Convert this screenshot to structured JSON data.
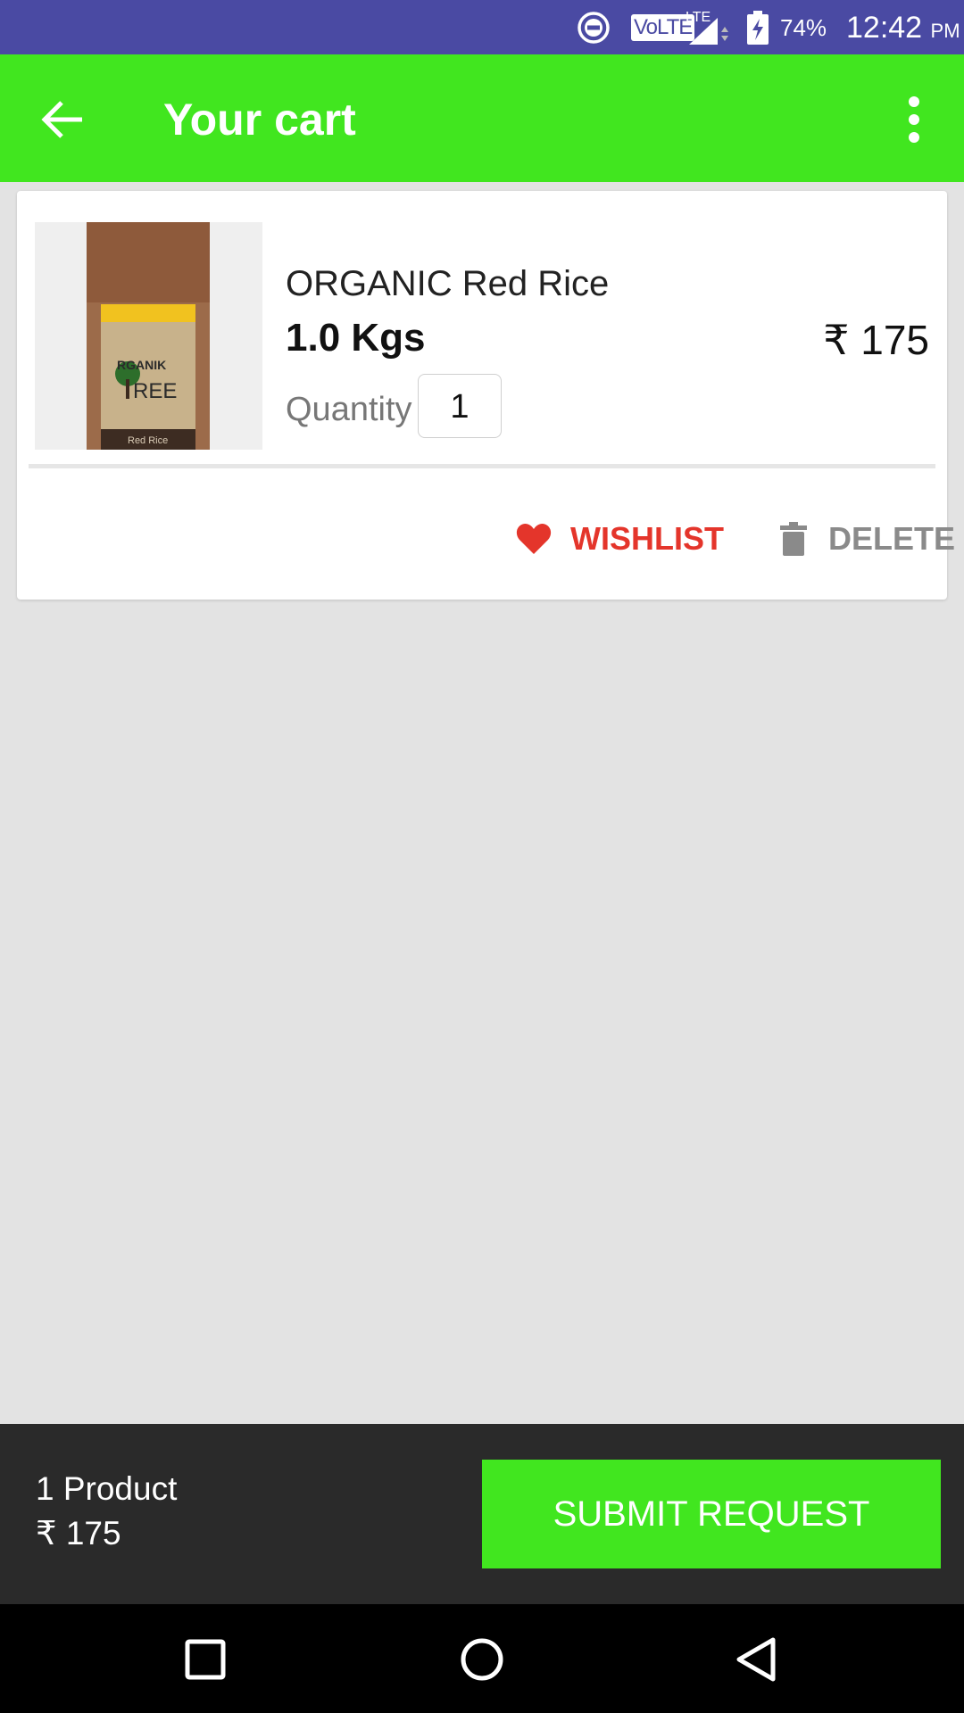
{
  "status_bar": {
    "volte": "VoLTE",
    "network": "LTE",
    "battery_percent": "74%",
    "time": "12:42",
    "ampm": "PM",
    "icons": [
      "do-not-disturb-icon",
      "volte-icon",
      "signal-icon",
      "battery-charging-icon"
    ]
  },
  "app_bar": {
    "title": "Your cart",
    "background": "#41e61f",
    "icons": [
      "arrow-back-icon",
      "more-vert-icon"
    ]
  },
  "cart_items": [
    {
      "name": "ORGANIC Red Rice",
      "weight": "1.0 Kgs",
      "price": "₹ 175",
      "quantity_label": "Quantity",
      "quantity": "1",
      "image_icon": "red-rice-package-image",
      "actions": {
        "wishlist": "WISHLIST",
        "delete": "DELETE"
      }
    }
  ],
  "summary": {
    "product_count": "1 Product",
    "total": "₹ 175",
    "submit_label": "SUBMIT REQUEST"
  },
  "colors": {
    "status_bar": "#4a4aa3",
    "accent_green": "#41e61f",
    "wishlist_red": "#e4352b",
    "summary_bar": "#2a2a2a"
  },
  "nav_bar": {
    "icons": [
      "recents-square-icon",
      "home-circle-icon",
      "back-triangle-icon"
    ]
  }
}
